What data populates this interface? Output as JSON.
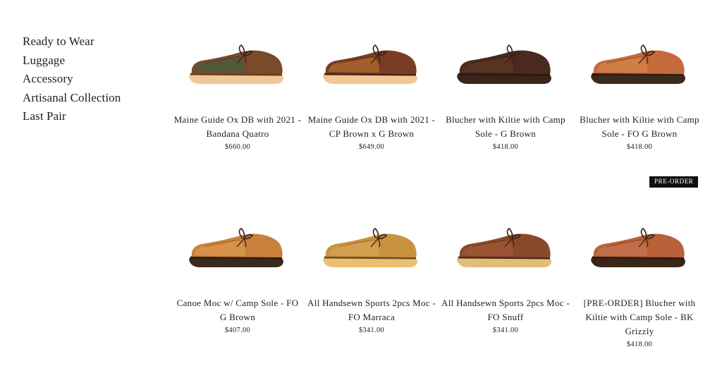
{
  "nav": {
    "items": [
      {
        "label": "Ready to Wear"
      },
      {
        "label": "Luggage"
      },
      {
        "label": "Accessory"
      },
      {
        "label": "Artisanal Collection"
      },
      {
        "label": "Last Pair"
      }
    ]
  },
  "products": [
    {
      "name": "Maine Guide Ox DB with 2021 - Bandana Quatro",
      "price": "$660.00",
      "upper": "#7a4a2a",
      "panel": "#4e5a3a",
      "sole": "#f0c898",
      "welt": "#6a3a22"
    },
    {
      "name": "Maine Guide Ox DB with 2021 - CP Brown x G Brown",
      "price": "$649.00",
      "upper": "#7a3c24",
      "panel": "#a8622c",
      "sole": "#f2c896",
      "welt": "#4a2414"
    },
    {
      "name": "Blucher with Kiltie with Camp Sole - G Brown",
      "price": "$418.00",
      "upper": "#4a2a1e",
      "panel": "#5a3424",
      "sole": "#3a2418",
      "welt": "#2a1810"
    },
    {
      "name": "Blucher with Kiltie with Camp Sole - FO G Brown",
      "price": "$418.00",
      "upper": "#c56a3a",
      "panel": "#d2804a",
      "sole": "#3a2a1e",
      "welt": "#2a1c12"
    },
    {
      "name": "Canoe Moc w/ Camp Sole - FO G Brown",
      "price": "$407.00",
      "upper": "#c8803a",
      "panel": "#d8924a",
      "sole": "#3a2a1e",
      "welt": "#2a1c12"
    },
    {
      "name": "All Handsewn Sports 2pcs Moc - FO Marraca",
      "price": "$341.00",
      "upper": "#c8923e",
      "panel": "#d4a050",
      "sole": "#e8c070",
      "welt": "#6a4a20"
    },
    {
      "name": "All Handsewn Sports 2pcs Moc - FO Snuff",
      "price": "$341.00",
      "upper": "#8a4a2a",
      "panel": "#9a5634",
      "sole": "#e2bc78",
      "welt": "#4a2a18"
    },
    {
      "name": "[PRE-ORDER] Blucher with Kiltie with Camp Sole - BK Grizzly",
      "price": "$418.00",
      "upper": "#b8623a",
      "panel": "#c4704a",
      "sole": "#3a2618",
      "welt": "#2a1a10",
      "badge": "PRE-ORDER"
    }
  ]
}
